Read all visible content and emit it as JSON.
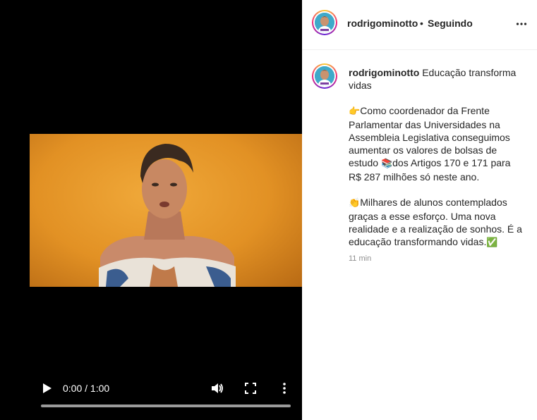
{
  "video": {
    "time_display": "0:00 / 1:00",
    "progress": 0,
    "icons": [
      "play-icon",
      "volume-icon",
      "fullscreen-icon",
      "more-vertical-icon"
    ]
  },
  "header": {
    "username": "rodrigominotto",
    "separator": "•",
    "follow_status": "Seguindo",
    "more_icon": "more-horizontal-icon"
  },
  "caption": {
    "username": "rodrigominotto",
    "title": "Educação transforma vidas",
    "p1_emoji": "👉",
    "p1_text_a": "Como coordenador da Frente Parlamentar das Universidades na Assembleia Legislativa conseguimos aumentar os valores de bolsas de estudo ",
    "p1_emoji2": "📚",
    "p1_text_b": "dos Artigos 170 e 171 para R$ 287 milhões só neste ano.",
    "p2_emoji": "👏",
    "p2_text": "Milhares de alunos contemplados graças a esse esforço. Uma nova realidade e a realização de sonhos. É a educação transformando vidas.",
    "p2_emoji2": "✅",
    "timestamp": "11 min"
  },
  "colors": {
    "accent_check": "#3cb043",
    "video_bg": "#e29124"
  }
}
